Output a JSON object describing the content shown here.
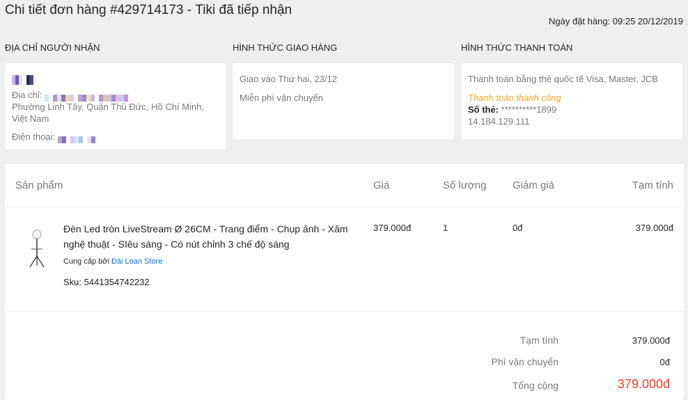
{
  "header": {
    "title": "Chi tiết đơn hàng #429714173 - ",
    "status": "Tiki đã tiếp nhận",
    "order_date": "Ngày đặt hàng: 09:25 20/12/2019"
  },
  "recipient": {
    "title": "ĐỊA CHỈ NGƯỜI NHẬN",
    "address_label": "Địa chỉ:",
    "address_tail": "Phường Linh Tây, Quận Thủ Đức, Hồ Chí Minh, Việt Nam",
    "phone_label": "Điện thoại:"
  },
  "shipping": {
    "title": "HÌNH THỨC GIAO HÀNG",
    "delivery": "Giao vào Thứ hai, 23/12",
    "fee": "Miễn phí vận chuyển"
  },
  "payment": {
    "title": "HÌNH THỨC THANH TOÁN",
    "method": "Thanh toán bằng thẻ quốc tế Visa, Master, JCB",
    "status": "Thanh toán thành công",
    "card_label": "Số thẻ:",
    "card_number": " **********1899",
    "ip": "14.184.129.111"
  },
  "table": {
    "headers": [
      "Sản phẩm",
      "Giá",
      "Số lượng",
      "Giảm giá",
      "Tạm tính"
    ],
    "items": [
      {
        "name": "Đèn Led tròn LiveStream Ø 26CM - Trang điểm - Chụp ảnh - Xăm nghệ thuật - SIêu sáng - Có nút chỉnh 3 chế độ sáng",
        "supplier_prefix": "Cung cấp bởi ",
        "supplier": "Đài Loan Store",
        "sku": "Sku: 5441354742232",
        "price": "379.000đ",
        "qty": "1",
        "discount": "0đ",
        "subtotal": "379.000đ"
      }
    ]
  },
  "summary": {
    "subtotal_label": "Tạm tính",
    "subtotal": "379.000đ",
    "shipping_label": "Phí vận chuyển",
    "shipping": "0đ",
    "total_label": "Tổng cộng",
    "total": "379.000đ"
  },
  "colors": {
    "success": "#fda223",
    "link": "#0b74e5",
    "total": "#ff3b27"
  }
}
